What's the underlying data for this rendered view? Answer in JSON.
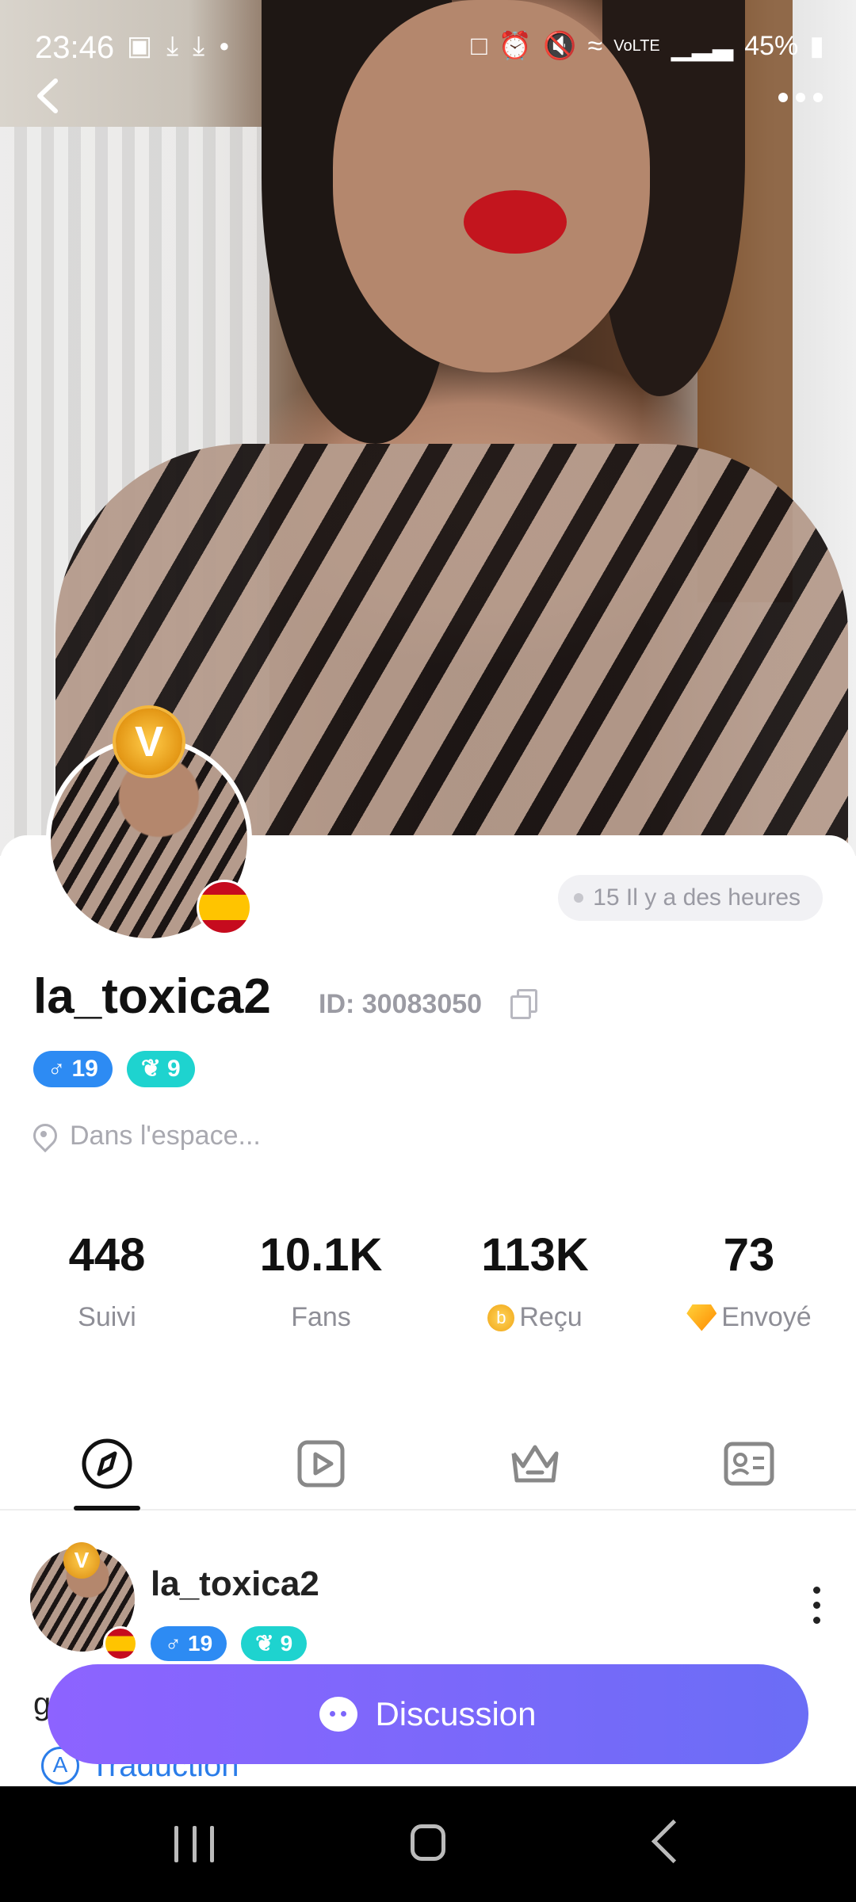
{
  "status_bar": {
    "time": "23:46",
    "battery": "45%",
    "left_icons": [
      "gallery-icon",
      "download-icon",
      "download-icon",
      "dot-icon"
    ],
    "right_icons": [
      "lock-icon",
      "alarm-icon",
      "mute-icon",
      "wifi-icon",
      "volte-icon",
      "signal-icon",
      "battery-icon"
    ]
  },
  "profile": {
    "online_status": "15 Il y a des heures",
    "username": "la_toxica2",
    "id_label": "ID: 30083050",
    "vip_letter": "V",
    "gender_age": "19",
    "level": "9",
    "location": "Dans l'espace..."
  },
  "stats": [
    {
      "value": "448",
      "label": "Suivi"
    },
    {
      "value": "10.1K",
      "label": "Fans"
    },
    {
      "value": "113K",
      "label": "Reçu"
    },
    {
      "value": "73",
      "label": "Envoyé"
    }
  ],
  "tabs": [
    {
      "icon": "compass-icon",
      "active": true
    },
    {
      "icon": "video-icon",
      "active": false
    },
    {
      "icon": "crown-icon",
      "active": false
    },
    {
      "icon": "profile-card-icon",
      "active": false
    }
  ],
  "post": {
    "author": "la_toxica2",
    "vip_letter": "V",
    "gender_age": "19",
    "level": "9",
    "text": "g",
    "translate_label": "Traduction",
    "translate_icon_letter": "A"
  },
  "cta": {
    "label": "Discussion"
  },
  "colors": {
    "accent_start": "#8d63ff",
    "accent_end": "#6b6df6",
    "badge_blue": "#2d8bf3",
    "badge_teal": "#1ed3cf",
    "link_blue": "#2b7de9"
  }
}
